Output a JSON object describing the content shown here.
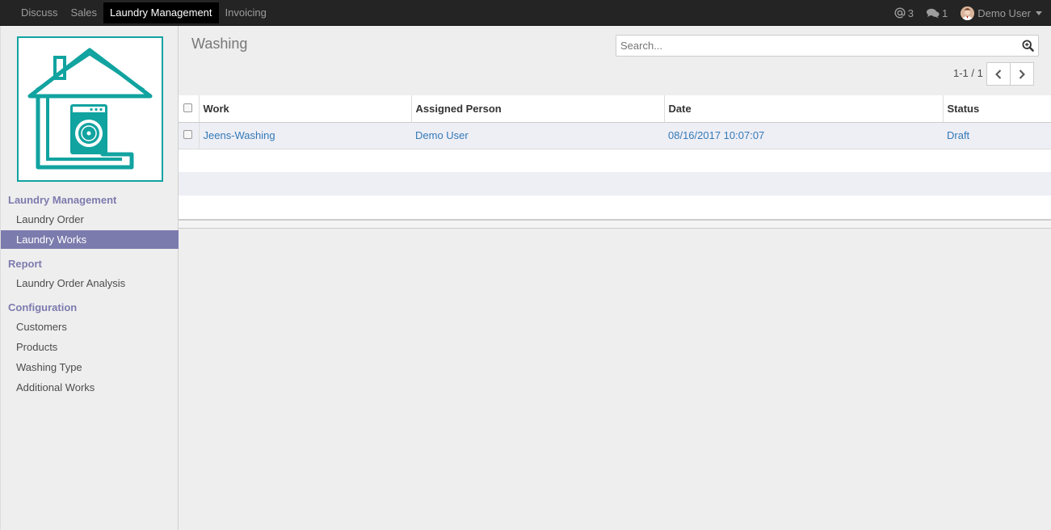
{
  "topbar": {
    "menu": [
      "Discuss",
      "Sales",
      "Laundry Management",
      "Invoicing"
    ],
    "active_menu": "Laundry Management",
    "mentions_count": "3",
    "messages_count": "1",
    "user_name": "Demo User"
  },
  "sidebar": {
    "sections": [
      {
        "title": "Laundry Management",
        "items": [
          "Laundry Order",
          "Laundry Works"
        ]
      },
      {
        "title": "Report",
        "items": [
          "Laundry Order Analysis"
        ]
      },
      {
        "title": "Configuration",
        "items": [
          "Customers",
          "Products",
          "Washing Type",
          "Additional Works"
        ]
      }
    ],
    "active_item": "Laundry Works"
  },
  "control_panel": {
    "title": "Washing",
    "search_placeholder": "Search...",
    "pager_value": "1-1 / 1"
  },
  "table": {
    "columns": [
      "Work",
      "Assigned Person",
      "Date",
      "Status"
    ],
    "rows": [
      {
        "work": "Jeens-Washing",
        "assigned_person": "Demo User",
        "date": "08/16/2017 10:07:07",
        "status": "Draft"
      }
    ]
  },
  "colors": {
    "accent": "#7c7bad",
    "link": "#337ab7",
    "logo": "#11a3a0"
  }
}
